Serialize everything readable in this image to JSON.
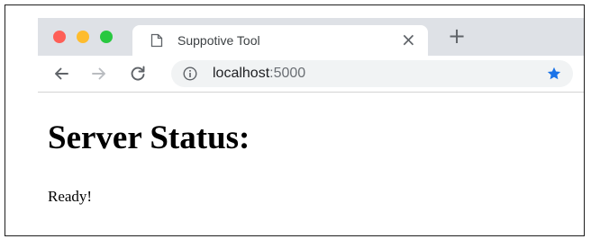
{
  "browser": {
    "tab": {
      "title": "Suppotive Tool",
      "close_glyph": "×"
    },
    "new_tab_glyph": "+",
    "address_bar": {
      "host": "localhost",
      "port": ":5000"
    },
    "icons": {
      "tab": "document-icon",
      "back": "back-arrow-icon",
      "forward": "forward-arrow-icon",
      "reload": "reload-icon",
      "info": "info-icon",
      "bookmark": "star-icon"
    },
    "colors": {
      "close_red": "#fe5f57",
      "minimize_yellow": "#febc2e",
      "maximize_green": "#28c840",
      "star_blue": "#1a73e8",
      "tab_strip": "#dee1e6"
    }
  },
  "page": {
    "heading": "Server Status:",
    "status": "Ready!"
  }
}
